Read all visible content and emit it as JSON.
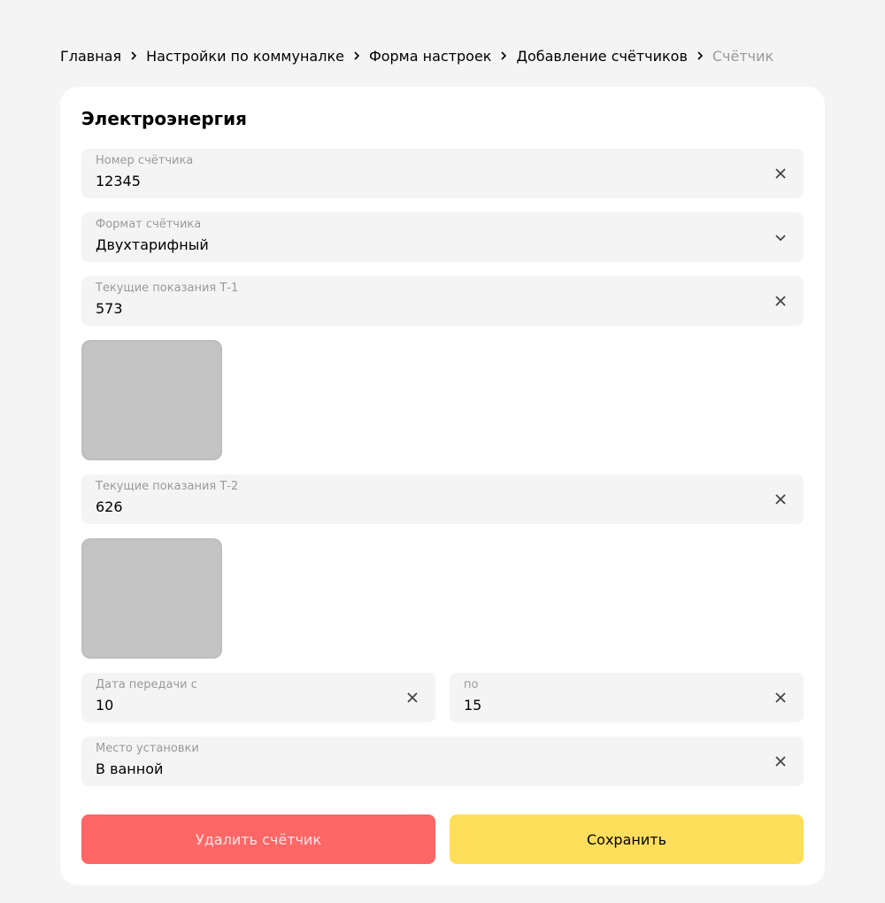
{
  "breadcrumb": {
    "items": [
      "Главная",
      "Настройки по коммуналке",
      "Форма настроек",
      "Добавление счётчиков"
    ],
    "current": "Счётчик"
  },
  "card": {
    "title": "Электроэнергия"
  },
  "fields": {
    "meter_number": {
      "label": "Номер счётчика",
      "value": "12345"
    },
    "meter_format": {
      "label": "Формат счётчика",
      "value": "Двухтарифный"
    },
    "reading_t1": {
      "label": "Текущие показания Т-1",
      "value": "573"
    },
    "reading_t2": {
      "label": "Текущие показания Т-2",
      "value": "626"
    },
    "date_from": {
      "label": "Дата передачи с",
      "value": "10"
    },
    "date_to": {
      "label": "по",
      "value": "15"
    },
    "location": {
      "label": "Место установки",
      "value": "В ванной"
    }
  },
  "buttons": {
    "delete_label": "Удалить счётчик",
    "save_label": "Сохранить"
  },
  "icons": {
    "clear": "close-icon",
    "dropdown": "chevron-down-icon",
    "separator": "chevron-right-icon"
  },
  "colors": {
    "page_bg": "#f4f4f5",
    "field_bg": "#f4f4f5",
    "delete_bg": "#ff6666",
    "save_bg": "#ffde5c"
  }
}
